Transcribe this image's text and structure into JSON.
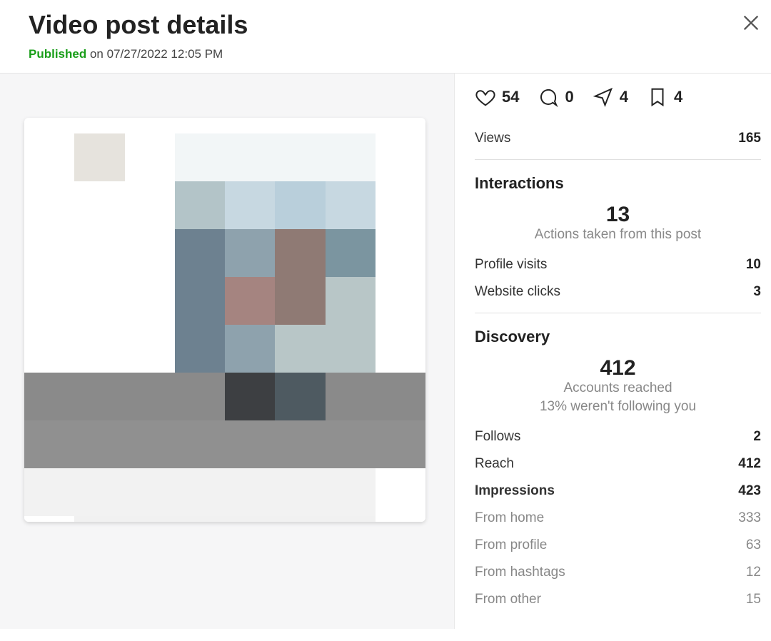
{
  "header": {
    "title": "Video post details",
    "published_label": "Published",
    "date_prefix": "on",
    "date": "07/27/2022 12:05 PM"
  },
  "engagement": {
    "likes": "54",
    "comments": "0",
    "shares": "4",
    "saves": "4"
  },
  "views": {
    "label": "Views",
    "value": "165"
  },
  "interactions": {
    "title": "Interactions",
    "total": "13",
    "subtitle": "Actions taken from this post",
    "rows": [
      {
        "label": "Profile visits",
        "value": "10"
      },
      {
        "label": "Website clicks",
        "value": "3"
      }
    ]
  },
  "discovery": {
    "title": "Discovery",
    "total": "412",
    "subtitle1": "Accounts reached",
    "subtitle2": "13% weren't following you",
    "rows": [
      {
        "label": "Follows",
        "value": "2",
        "style": "normal"
      },
      {
        "label": "Reach",
        "value": "412",
        "style": "normal-bold-value"
      },
      {
        "label": "Impressions",
        "value": "423",
        "style": "bold"
      },
      {
        "label": "From home",
        "value": "333",
        "style": "light"
      },
      {
        "label": "From profile",
        "value": "63",
        "style": "light"
      },
      {
        "label": "From hashtags",
        "value": "12",
        "style": "light"
      },
      {
        "label": "From other",
        "value": "15",
        "style": "light"
      }
    ]
  },
  "mosaic_colors": [
    "#ffffff",
    "#e6e3dd",
    "#ffffff",
    "#f2f6f7",
    "#f2f6f7",
    "#f2f6f7",
    "#f2f6f7",
    "#ffffff",
    "#ffffff",
    "#ffffff",
    "#ffffff",
    "#b3c4c8",
    "#c7d8e1",
    "#b9cfdb",
    "#c7d8e1",
    "#ffffff",
    "#ffffff",
    "#ffffff",
    "#ffffff",
    "#6d8190",
    "#8ea2ad",
    "#8f7a74",
    "#7b95a0",
    "#ffffff",
    "#ffffff",
    "#ffffff",
    "#ffffff",
    "#6d8190",
    "#a58480",
    "#8f7a74",
    "#b8c6c7",
    "#ffffff",
    "#ffffff",
    "#ffffff",
    "#ffffff",
    "#6d8190",
    "#8ea2ad",
    "#b8c6c7",
    "#b8c6c7",
    "#ffffff",
    "#8a8a8a",
    "#8a8a8a",
    "#8a8a8a",
    "#8a8a8a",
    "#3d3f42",
    "#4e5a61",
    "#8a8a8a",
    "#8a8a8a",
    "#909090",
    "#909090",
    "#909090",
    "#909090",
    "#909090",
    "#909090",
    "#909090",
    "#909090",
    "#f2f2f2",
    "#f2f2f2",
    "#f2f2f2",
    "#f2f2f2",
    "#f2f2f2",
    "#f2f2f2",
    "#f2f2f2",
    "#ffffff",
    "#ffffff",
    "#f1f1f1",
    "#f1f1f1",
    "#f1f1f1",
    "#f1f1f1",
    "#f1f1f1",
    "#f1f1f1",
    "#ffffff"
  ]
}
